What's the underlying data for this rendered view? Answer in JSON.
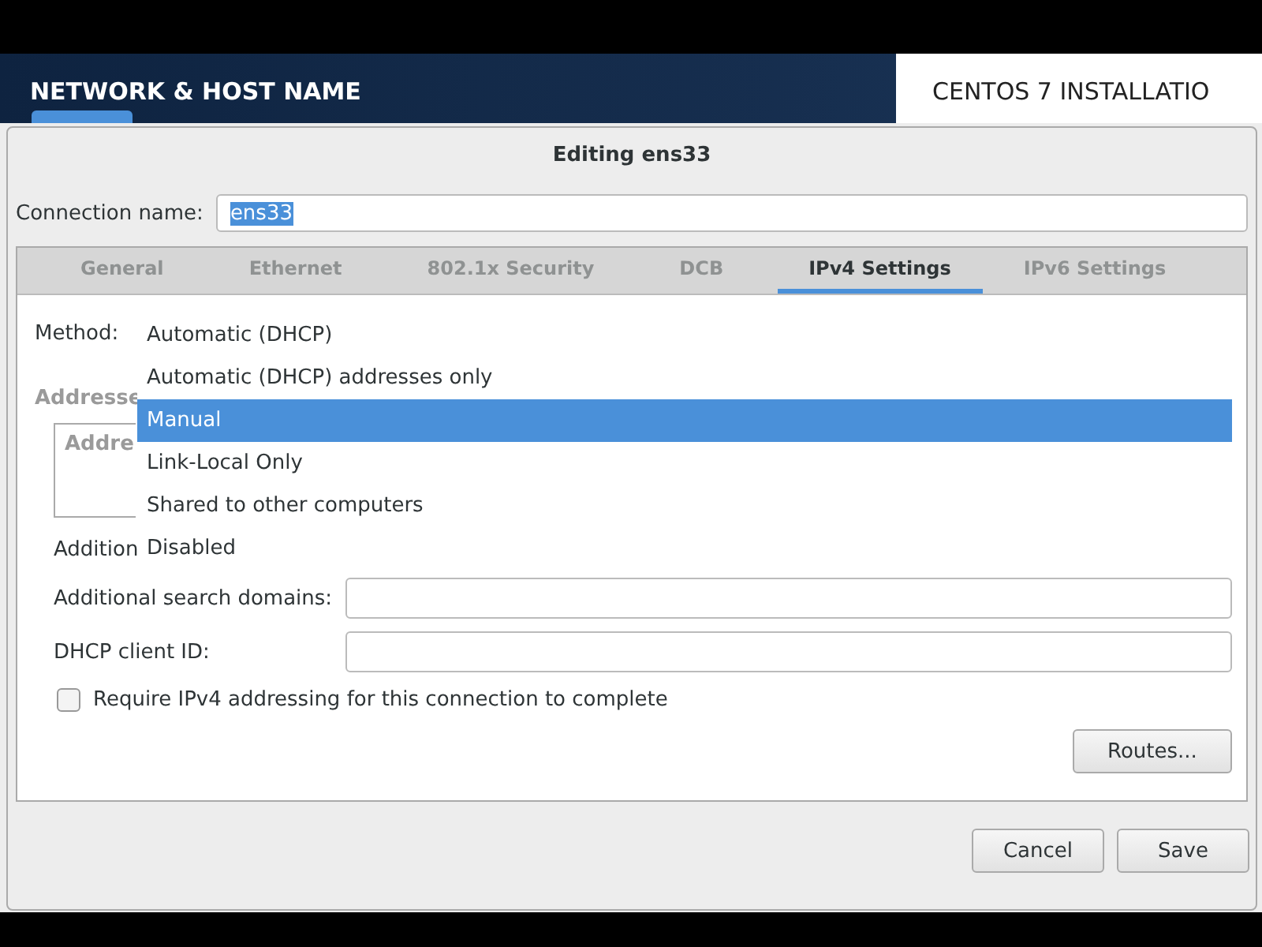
{
  "header": {
    "title": "NETWORK & HOST NAME",
    "product": "CENTOS 7 INSTALLATIO"
  },
  "dialog": {
    "title": "Editing ens33",
    "connection": {
      "label": "Connection name:",
      "value": "ens33"
    },
    "tabs": [
      {
        "label": "General",
        "selected": false
      },
      {
        "label": "Ethernet",
        "selected": false
      },
      {
        "label": "802.1x Security",
        "selected": false
      },
      {
        "label": "DCB",
        "selected": false
      },
      {
        "label": "IPv4 Settings",
        "selected": true
      },
      {
        "label": "IPv6 Settings",
        "selected": false
      }
    ],
    "method": {
      "label": "Method:",
      "options": [
        {
          "label": "Automatic (DHCP)",
          "selected": false
        },
        {
          "label": "Automatic (DHCP) addresses only",
          "selected": false
        },
        {
          "label": "Manual",
          "selected": true
        },
        {
          "label": "Link-Local Only",
          "selected": false
        },
        {
          "label": "Shared to other computers",
          "selected": false
        },
        {
          "label": "Disabled",
          "selected": false
        }
      ]
    },
    "addresses_label": "Addresse",
    "addresses_column": "Addre",
    "dns_label": "Addition",
    "fields": [
      {
        "label": "Additional search domains:"
      },
      {
        "label": "DHCP client ID:"
      }
    ],
    "require": {
      "label": "Require IPv4 addressing for this connection to complete",
      "checked": false
    },
    "routes_button": "Routes...",
    "buttons": [
      "Cancel",
      "Save"
    ]
  }
}
